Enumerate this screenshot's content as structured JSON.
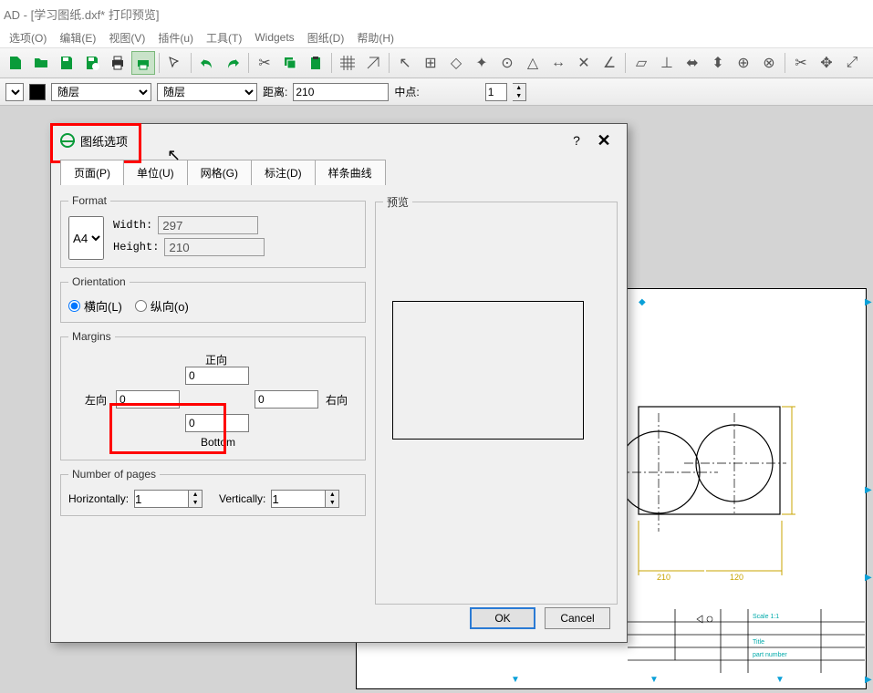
{
  "window_title": "AD - [学习图纸.dxf* 打印预览]",
  "menus": [
    "选项(O)",
    "编辑(E)",
    "视图(V)",
    "插件(u)",
    "工具(T)",
    "Widgets",
    "图纸(D)",
    "帮助(H)"
  ],
  "optbar": {
    "layer1_value": "随层",
    "layer2_value": "随层",
    "dist_label": "距离:",
    "dist_value": "210",
    "mid_label": "中点:",
    "num_value": "1"
  },
  "dialog": {
    "title": "图纸选项",
    "help": "?",
    "close": "✕",
    "tabs": [
      "页面(P)",
      "单位(U)",
      "网格(G)",
      "标注(D)",
      "样条曲线"
    ],
    "format_legend": "Format",
    "format_select": "A4",
    "width_label": "Width:",
    "width_value": "297",
    "height_label": "Height:",
    "height_value": "210",
    "orient_legend": "Orientation",
    "orient_landscape": "横向(L)",
    "orient_portrait": "纵向(o)",
    "margins_legend": "Margins",
    "margin_top_label": "正向",
    "margin_left_label": "左向",
    "margin_right_label": "右向",
    "margin_bottom_label": "Bottom",
    "margin_top": "0",
    "margin_left": "0",
    "margin_right": "0",
    "margin_bottom": "0",
    "pages_legend": "Number of pages",
    "pages_h_label": "Horizontally:",
    "pages_h": "1",
    "pages_v_label": "Vertically:",
    "pages_v": "1",
    "preview_legend": "预览",
    "ok": "OK",
    "cancel": "Cancel"
  },
  "drawing": {
    "dim_left": "210",
    "dim_right": "120",
    "titleblock_scale": "Scale 1:1",
    "titleblock_title": "Title",
    "titleblock_part": "part number"
  }
}
